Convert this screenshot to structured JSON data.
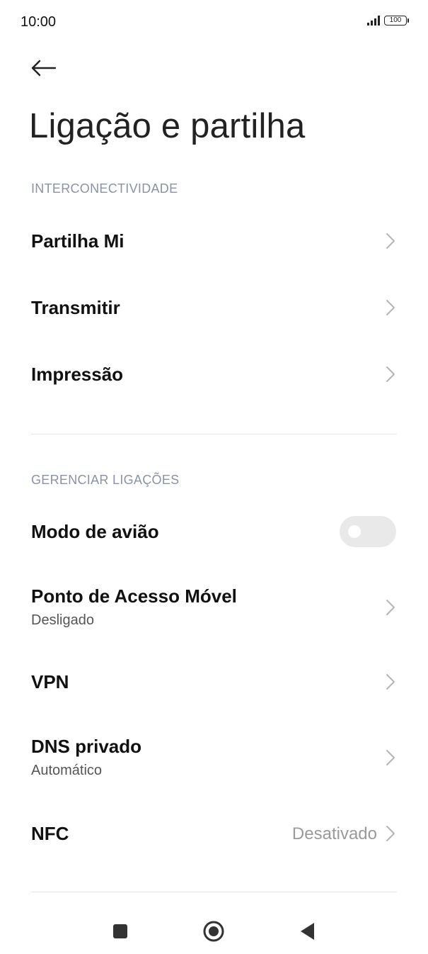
{
  "status_bar": {
    "time": "10:00",
    "battery_level": "100",
    "signal_icon": "signal-bars-icon",
    "battery_icon": "battery-icon"
  },
  "header": {
    "back_icon": "arrow-left-icon",
    "title": "Ligação e partilha"
  },
  "sections": {
    "interconnectivity": {
      "header": "INTERCONECTIVIDADE",
      "items": [
        {
          "label": "Partilha Mi"
        },
        {
          "label": "Transmitir"
        },
        {
          "label": "Impressão"
        }
      ]
    },
    "manage_connections": {
      "header": "GERENCIAR LIGAÇÕES",
      "airplane": {
        "label": "Modo de avião",
        "enabled": false
      },
      "hotspot": {
        "label": "Ponto de Acesso Móvel",
        "sub": "Desligado"
      },
      "vpn": {
        "label": "VPN"
      },
      "private_dns": {
        "label": "DNS privado",
        "sub": "Automático"
      },
      "nfc": {
        "label": "NFC",
        "value": "Desativado"
      }
    }
  },
  "nav_bar": {
    "recents_icon": "square-icon",
    "home_icon": "circle-icon",
    "back_icon": "triangle-back-icon"
  },
  "colors": {
    "section_header": "#8a92a8",
    "toggle_off": "#e9e9e9",
    "secondary_text": "#9a9a9a"
  }
}
